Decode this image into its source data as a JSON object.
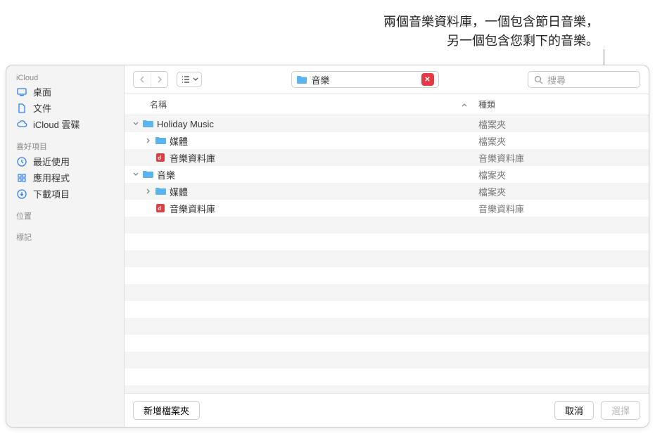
{
  "callout": {
    "line1": "兩個音樂資料庫，一個包含節日音樂，",
    "line2": "另一個包含您剩下的音樂。"
  },
  "sidebar": {
    "sections": [
      {
        "header": "iCloud",
        "items": [
          {
            "icon": "desktop",
            "label": "桌面"
          },
          {
            "icon": "document",
            "label": "文件"
          },
          {
            "icon": "cloud",
            "label": "iCloud 雲碟"
          }
        ]
      },
      {
        "header": "喜好項目",
        "items": [
          {
            "icon": "clock",
            "label": "最近使用"
          },
          {
            "icon": "app-grid",
            "label": "應用程式"
          },
          {
            "icon": "download",
            "label": "下載項目"
          }
        ]
      },
      {
        "header": "位置",
        "items": []
      },
      {
        "header": "標記",
        "items": []
      }
    ]
  },
  "toolbar": {
    "location_label": "音樂",
    "search_placeholder": "搜尋"
  },
  "columns": {
    "name": "名稱",
    "type": "種類"
  },
  "rows": [
    {
      "indent": 0,
      "disclosure": "down",
      "icon": "folder",
      "name": "Holiday Music",
      "type": "檔案夾"
    },
    {
      "indent": 1,
      "disclosure": "right",
      "icon": "folder",
      "name": "媒體",
      "type": "檔案夾"
    },
    {
      "indent": 1,
      "disclosure": "",
      "icon": "musiclib",
      "name": "音樂資料庫",
      "type": "音樂資料庫"
    },
    {
      "indent": 0,
      "disclosure": "down",
      "icon": "folder",
      "name": "音樂",
      "type": "檔案夾"
    },
    {
      "indent": 1,
      "disclosure": "right",
      "icon": "folder",
      "name": "媒體",
      "type": "檔案夾"
    },
    {
      "indent": 1,
      "disclosure": "",
      "icon": "musiclib",
      "name": "音樂資料庫",
      "type": "音樂資料庫"
    }
  ],
  "footer": {
    "new_folder": "新增檔案夾",
    "cancel": "取消",
    "choose": "選擇"
  }
}
